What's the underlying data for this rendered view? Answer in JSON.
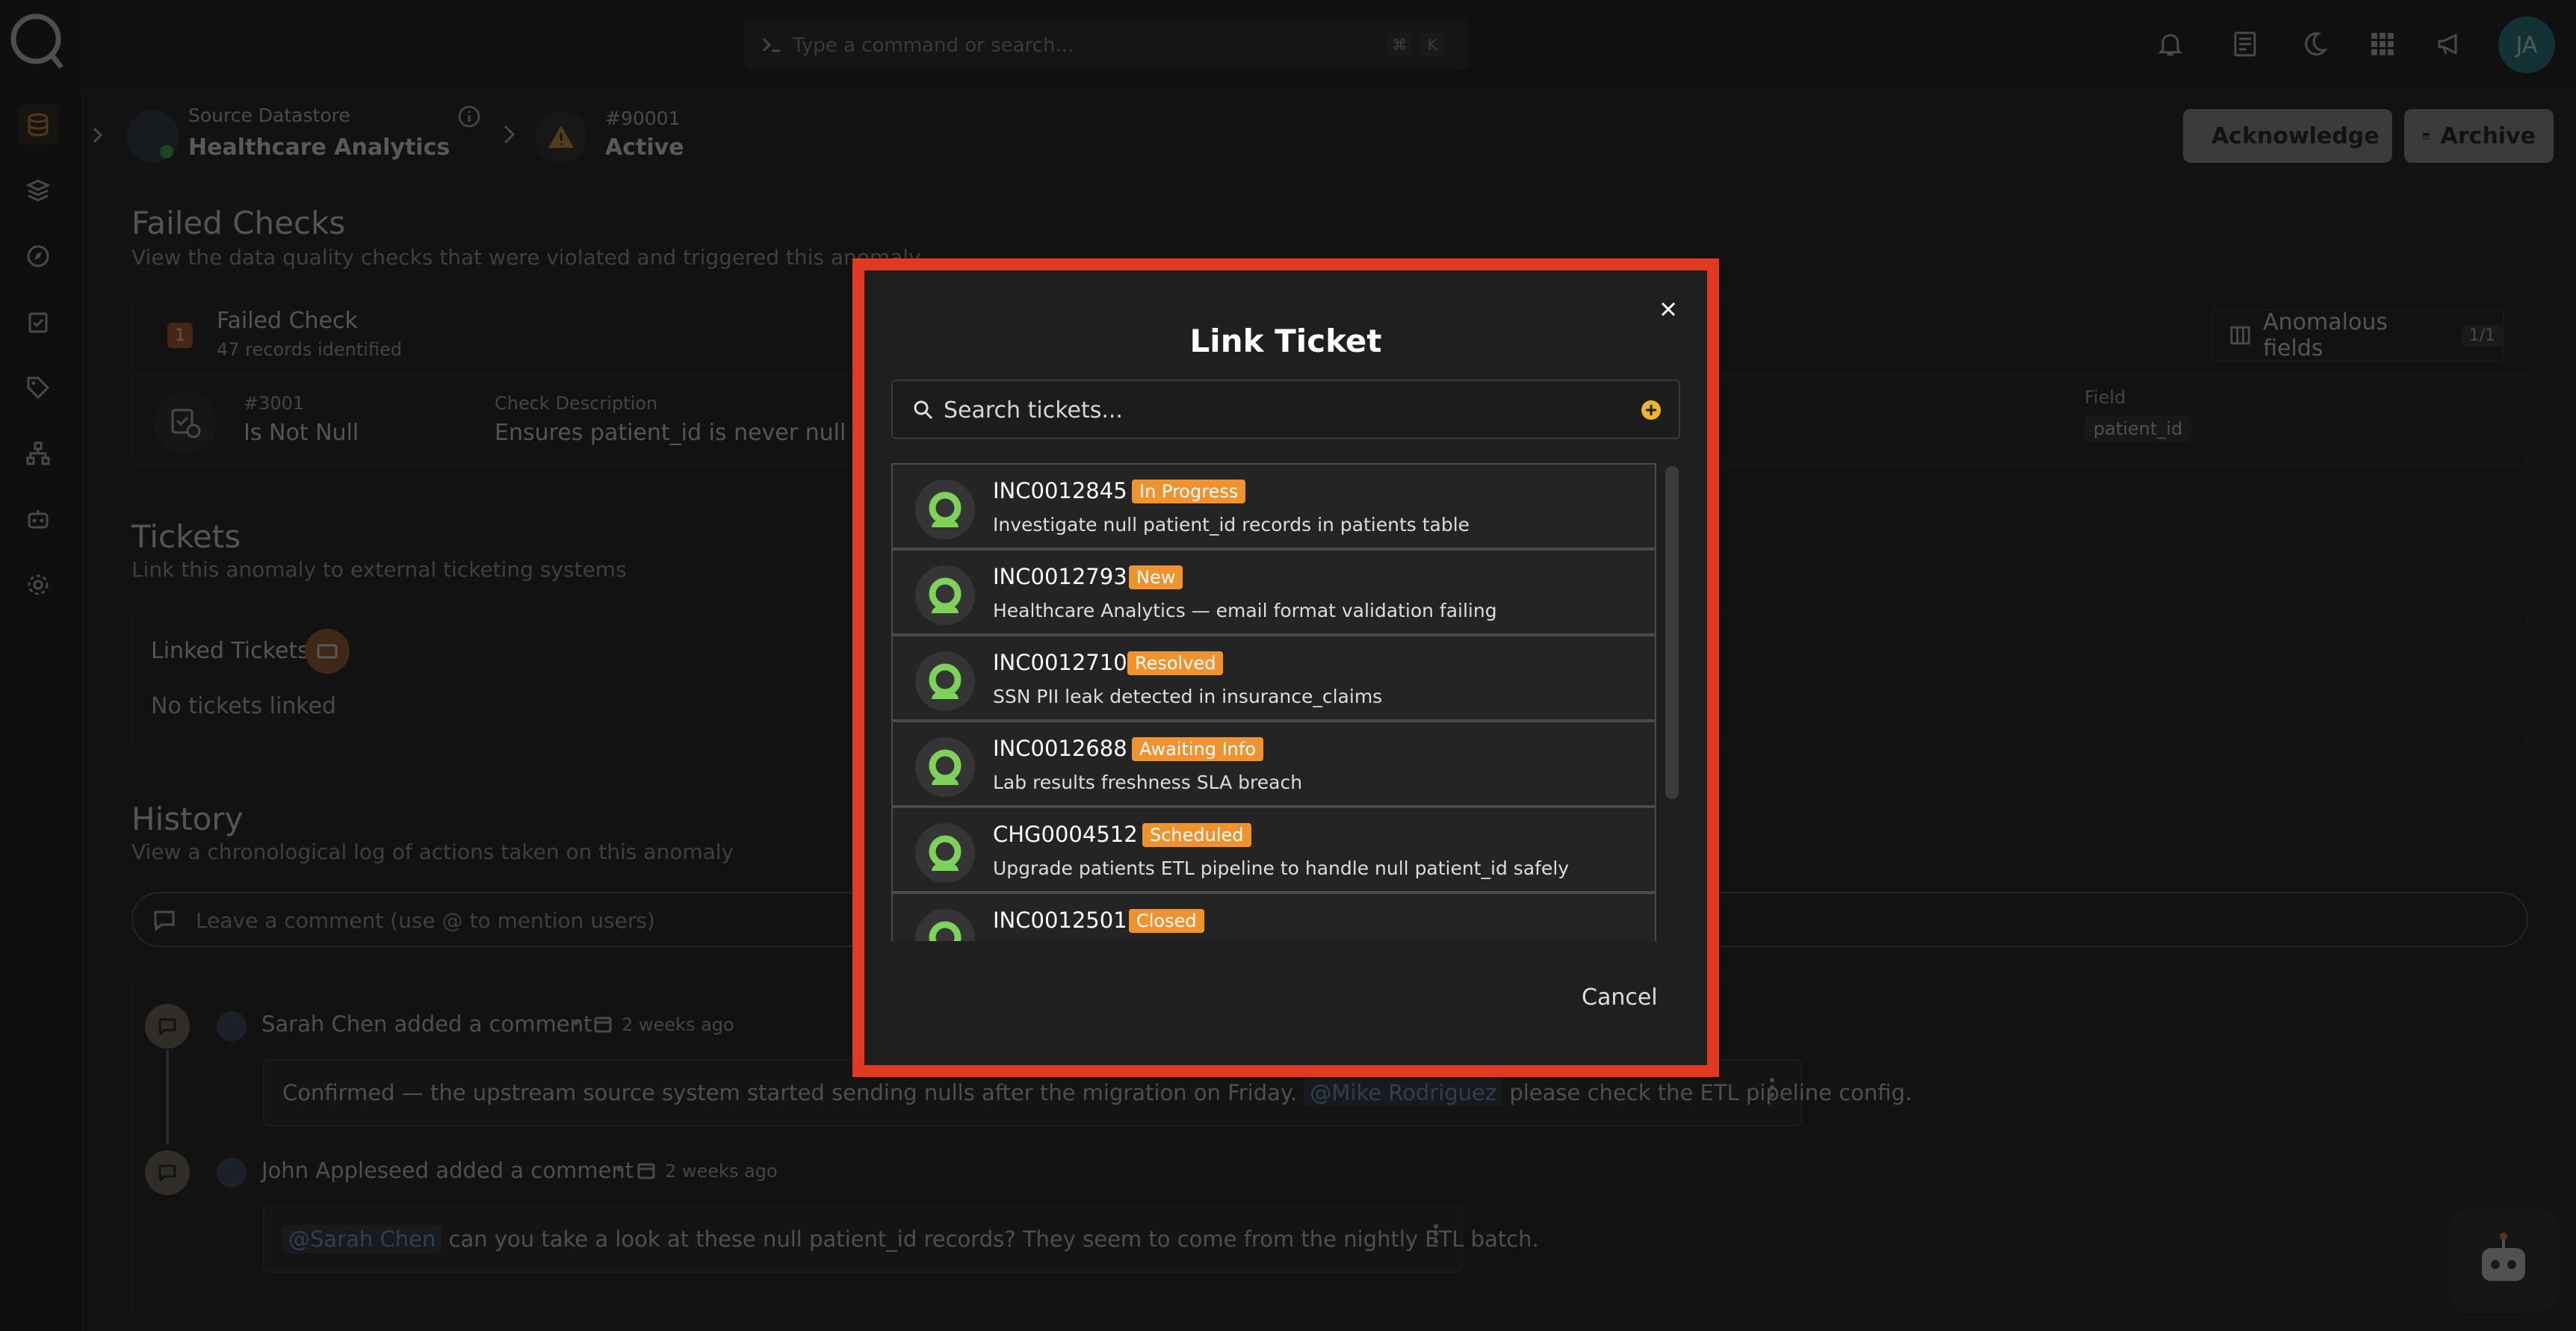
{
  "command_bar": {
    "placeholder": "Type a command or search...",
    "key1": "⌘",
    "key2": "K"
  },
  "user": {
    "initials": "JA"
  },
  "header": {
    "datastore_label": "Source Datastore",
    "datastore_name": "Healthcare Analytics",
    "anomaly_id": "#90001",
    "anomaly_status": "Active",
    "acknowledge_label": "Acknowledge",
    "archive_label": "Archive"
  },
  "failed_checks": {
    "title": "Failed Checks",
    "subtitle": "View the data quality checks that were violated and triggered this anomaly",
    "count": "1",
    "heading": "Failed Check",
    "records": "47 records identified",
    "anomalous_label": "Anomalous fields",
    "anomalous_count": "1/1",
    "check_id": "#3001",
    "check_rule": "Is Not Null",
    "desc_label": "Check Description",
    "desc_value": "Ensures patient_id is never null",
    "field_label": "Field",
    "field_value": "patient_id"
  },
  "tickets": {
    "title": "Tickets",
    "subtitle": "Link this anomaly to external ticketing systems",
    "linked_label": "Linked Tickets",
    "empty": "No tickets linked"
  },
  "history": {
    "title": "History",
    "subtitle": "View a chronological log of actions taken on this anomaly",
    "comment_placeholder": "Leave a comment (use @ to mention users)",
    "entries": [
      {
        "author": "Sarah Chen added a comment",
        "time": "2 weeks ago",
        "mention": "@Mike Rodriguez",
        "text_before": "Confirmed — the upstream source system started sending nulls after the migration on Friday.",
        "text_after": "please check the ETL pipeline config."
      },
      {
        "author": "John Appleseed added a comment",
        "time": "2 weeks ago",
        "mention": "@Sarah Chen",
        "text_before": "",
        "text_after": "can you take a look at these null patient_id records? They seem to come from the nightly ETL batch."
      }
    ]
  },
  "modal": {
    "title": "Link Ticket",
    "search_placeholder": "Search tickets...",
    "cancel_label": "Cancel",
    "tickets": [
      {
        "id": "INC0012845",
        "status": "In Progress",
        "desc": "Investigate null patient_id records in patients table"
      },
      {
        "id": "INC0012793",
        "status": "New",
        "desc": "Healthcare Analytics — email format validation failing"
      },
      {
        "id": "INC0012710",
        "status": "Resolved",
        "desc": "SSN PII leak detected in insurance_claims"
      },
      {
        "id": "INC0012688",
        "status": "Awaiting Info",
        "desc": "Lab results freshness SLA breach"
      },
      {
        "id": "CHG0004512",
        "status": "Scheduled",
        "desc": "Upgrade patients ETL pipeline to handle null patient_id safely"
      },
      {
        "id": "INC0012501",
        "status": "Closed",
        "desc": ""
      }
    ]
  },
  "colors": {
    "accent": "#f0932f",
    "frame": "#e23a21",
    "success_icon": "#7dd35a"
  }
}
